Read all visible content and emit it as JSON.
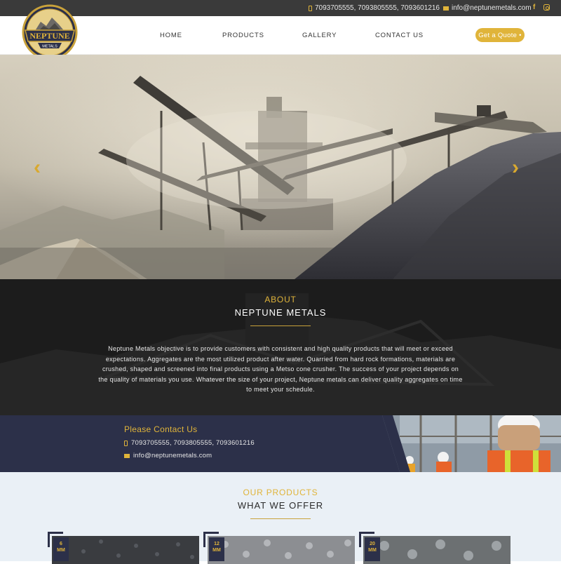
{
  "topbar": {
    "phones": "7093705555, 7093805555, 7093601216",
    "email": "info@neptunemetals.com",
    "social": [
      "facebook-icon",
      "instagram-icon"
    ]
  },
  "brand": {
    "name": "NEPTUNE",
    "sub": "METALS"
  },
  "nav": {
    "home": "HOME",
    "products": "PRODUCTS",
    "gallery": "GALLERY",
    "contact": "CONTACT US",
    "quote": "Get a Quote •"
  },
  "about": {
    "eyebrow": "ABOUT",
    "title": "NEPTUNE METALS",
    "text": "Neptune Metals objective is to provide customers with consistent and high quality products that will meet or exceed expectations. Aggregates are the most utilized product after water. Quarried from hard rock formations, materials are crushed, shaped and screened into final products using a Metso cone crusher. The success of your project depends on the quality of materials you use. Whatever the size of your project, Neptune metals can deliver quality aggregates on time to meet your schedule."
  },
  "contact": {
    "title": "Please Contact Us",
    "phones": "7093705555, 7093805555, 7093601216",
    "email": "info@neptunemetals.com"
  },
  "products": {
    "eyebrow": "OUR PRODUCTS",
    "title": "WHAT WE OFFER",
    "items": [
      {
        "size": "6",
        "unit": "MM"
      },
      {
        "size": "12",
        "unit": "MM"
      },
      {
        "size": "20",
        "unit": "MM"
      }
    ]
  },
  "colors": {
    "accent": "#e0b43a",
    "navy": "#2c3049",
    "topbar": "#3a3a3a",
    "about_bg": "#1e1e1e",
    "products_bg": "#eaf0f6"
  }
}
